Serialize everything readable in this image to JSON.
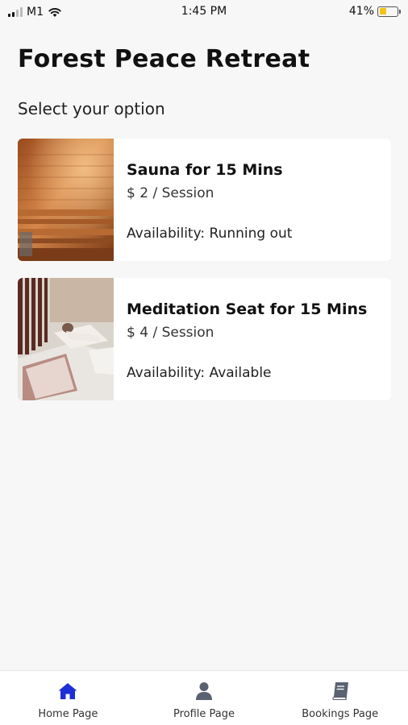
{
  "status_bar": {
    "carrier": "M1",
    "time": "1:45 PM",
    "battery_percent": "41%",
    "battery_level": 0.41,
    "battery_color": "#f3c417"
  },
  "header": {
    "title": "Forest Peace Retreat",
    "subtitle": "Select your option"
  },
  "options": [
    {
      "image_icon": "sauna-photo",
      "title": "Sauna for 15 Mins",
      "price": "$ 2 / Session",
      "availability": "Availability: Running out"
    },
    {
      "image_icon": "meditation-seat-photo",
      "title": "Meditation Seat for 15 Mins",
      "price": "$ 4 / Session",
      "availability": "Availability: Available"
    }
  ],
  "bottom_nav": {
    "items": [
      {
        "label": "Home Page",
        "icon": "home-icon",
        "active": true
      },
      {
        "label": "Profile Page",
        "icon": "user-icon",
        "active": false
      },
      {
        "label": "Bookings Page",
        "icon": "book-icon",
        "active": false
      }
    ],
    "active_color": "#1f2fd6",
    "inactive_color": "#5a6170"
  }
}
